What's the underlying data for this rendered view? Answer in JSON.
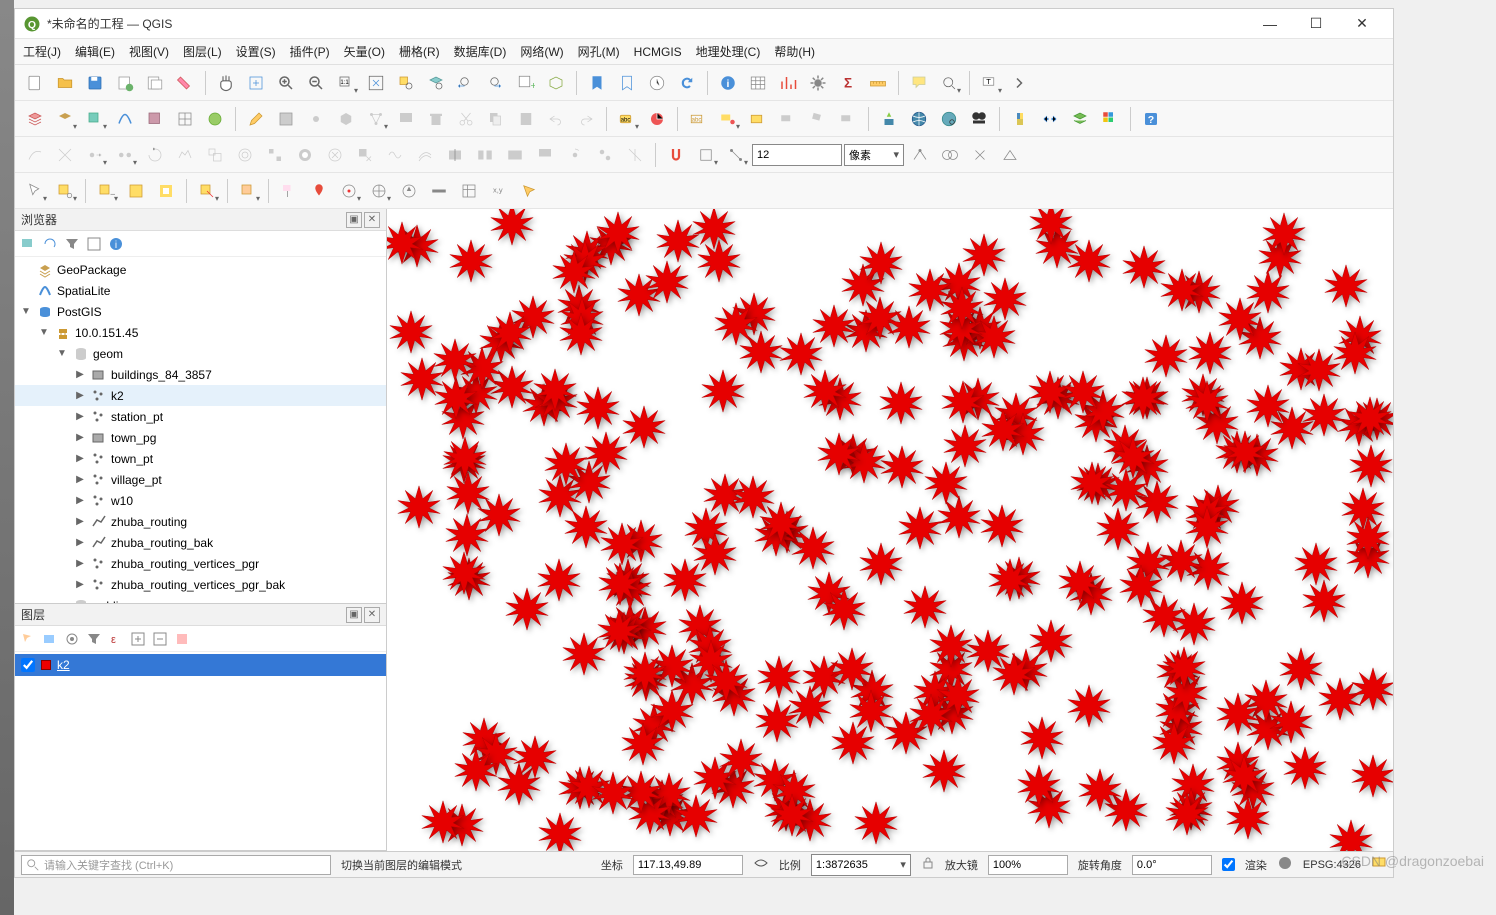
{
  "title": "*未命名的工程 — QGIS",
  "menus": [
    "工程(J)",
    "编辑(E)",
    "视图(V)",
    "图层(L)",
    "设置(S)",
    "插件(P)",
    "矢量(O)",
    "栅格(R)",
    "数据库(D)",
    "网络(W)",
    "网孔(M)",
    "HCMGIS",
    "地理处理(C)",
    "帮助(H)"
  ],
  "snap_value": "12",
  "snap_unit": "像素",
  "browser": {
    "title": "浏览器",
    "items": [
      {
        "ind": 0,
        "arrow": "",
        "icon": "geopackage",
        "label": "GeoPackage"
      },
      {
        "ind": 0,
        "arrow": "",
        "icon": "spatialite",
        "label": "SpatiaLite"
      },
      {
        "ind": 0,
        "arrow": "▼",
        "icon": "postgis",
        "label": "PostGIS"
      },
      {
        "ind": 1,
        "arrow": "▼",
        "icon": "conn",
        "label": "10.0.151.45"
      },
      {
        "ind": 2,
        "arrow": "▼",
        "icon": "schema",
        "label": "geom"
      },
      {
        "ind": 3,
        "arrow": "▶",
        "icon": "poly",
        "label": "buildings_84_3857"
      },
      {
        "ind": 3,
        "arrow": "▶",
        "icon": "point",
        "label": "k2",
        "sel": true
      },
      {
        "ind": 3,
        "arrow": "▶",
        "icon": "point",
        "label": "station_pt"
      },
      {
        "ind": 3,
        "arrow": "▶",
        "icon": "poly",
        "label": "town_pg"
      },
      {
        "ind": 3,
        "arrow": "▶",
        "icon": "point",
        "label": "town_pt"
      },
      {
        "ind": 3,
        "arrow": "▶",
        "icon": "point",
        "label": "village_pt"
      },
      {
        "ind": 3,
        "arrow": "▶",
        "icon": "point",
        "label": "w10"
      },
      {
        "ind": 3,
        "arrow": "▶",
        "icon": "line",
        "label": "zhuba_routing"
      },
      {
        "ind": 3,
        "arrow": "▶",
        "icon": "line",
        "label": "zhuba_routing_bak"
      },
      {
        "ind": 3,
        "arrow": "▶",
        "icon": "point",
        "label": "zhuba_routing_vertices_pgr"
      },
      {
        "ind": 3,
        "arrow": "▶",
        "icon": "point",
        "label": "zhuba_routing_vertices_pgr_bak"
      },
      {
        "ind": 2,
        "arrow": "",
        "icon": "schema",
        "label": "public"
      }
    ]
  },
  "layers": {
    "title": "图层",
    "active": "k2"
  },
  "status": {
    "search_placeholder": "请输入关键字查找 (Ctrl+K)",
    "editmode": "切换当前图层的编辑模式",
    "coord_label": "坐标",
    "coord": "117.13,49.89",
    "scale_label": "比例",
    "scale": "1:3872635",
    "mag_label": "放大镜",
    "mag": "100%",
    "rot_label": "旋转角度",
    "rot": "0.0°",
    "render": "渲染",
    "epsg": "EPSG:4326"
  },
  "watermark": "CSDN @dragonzoebai"
}
